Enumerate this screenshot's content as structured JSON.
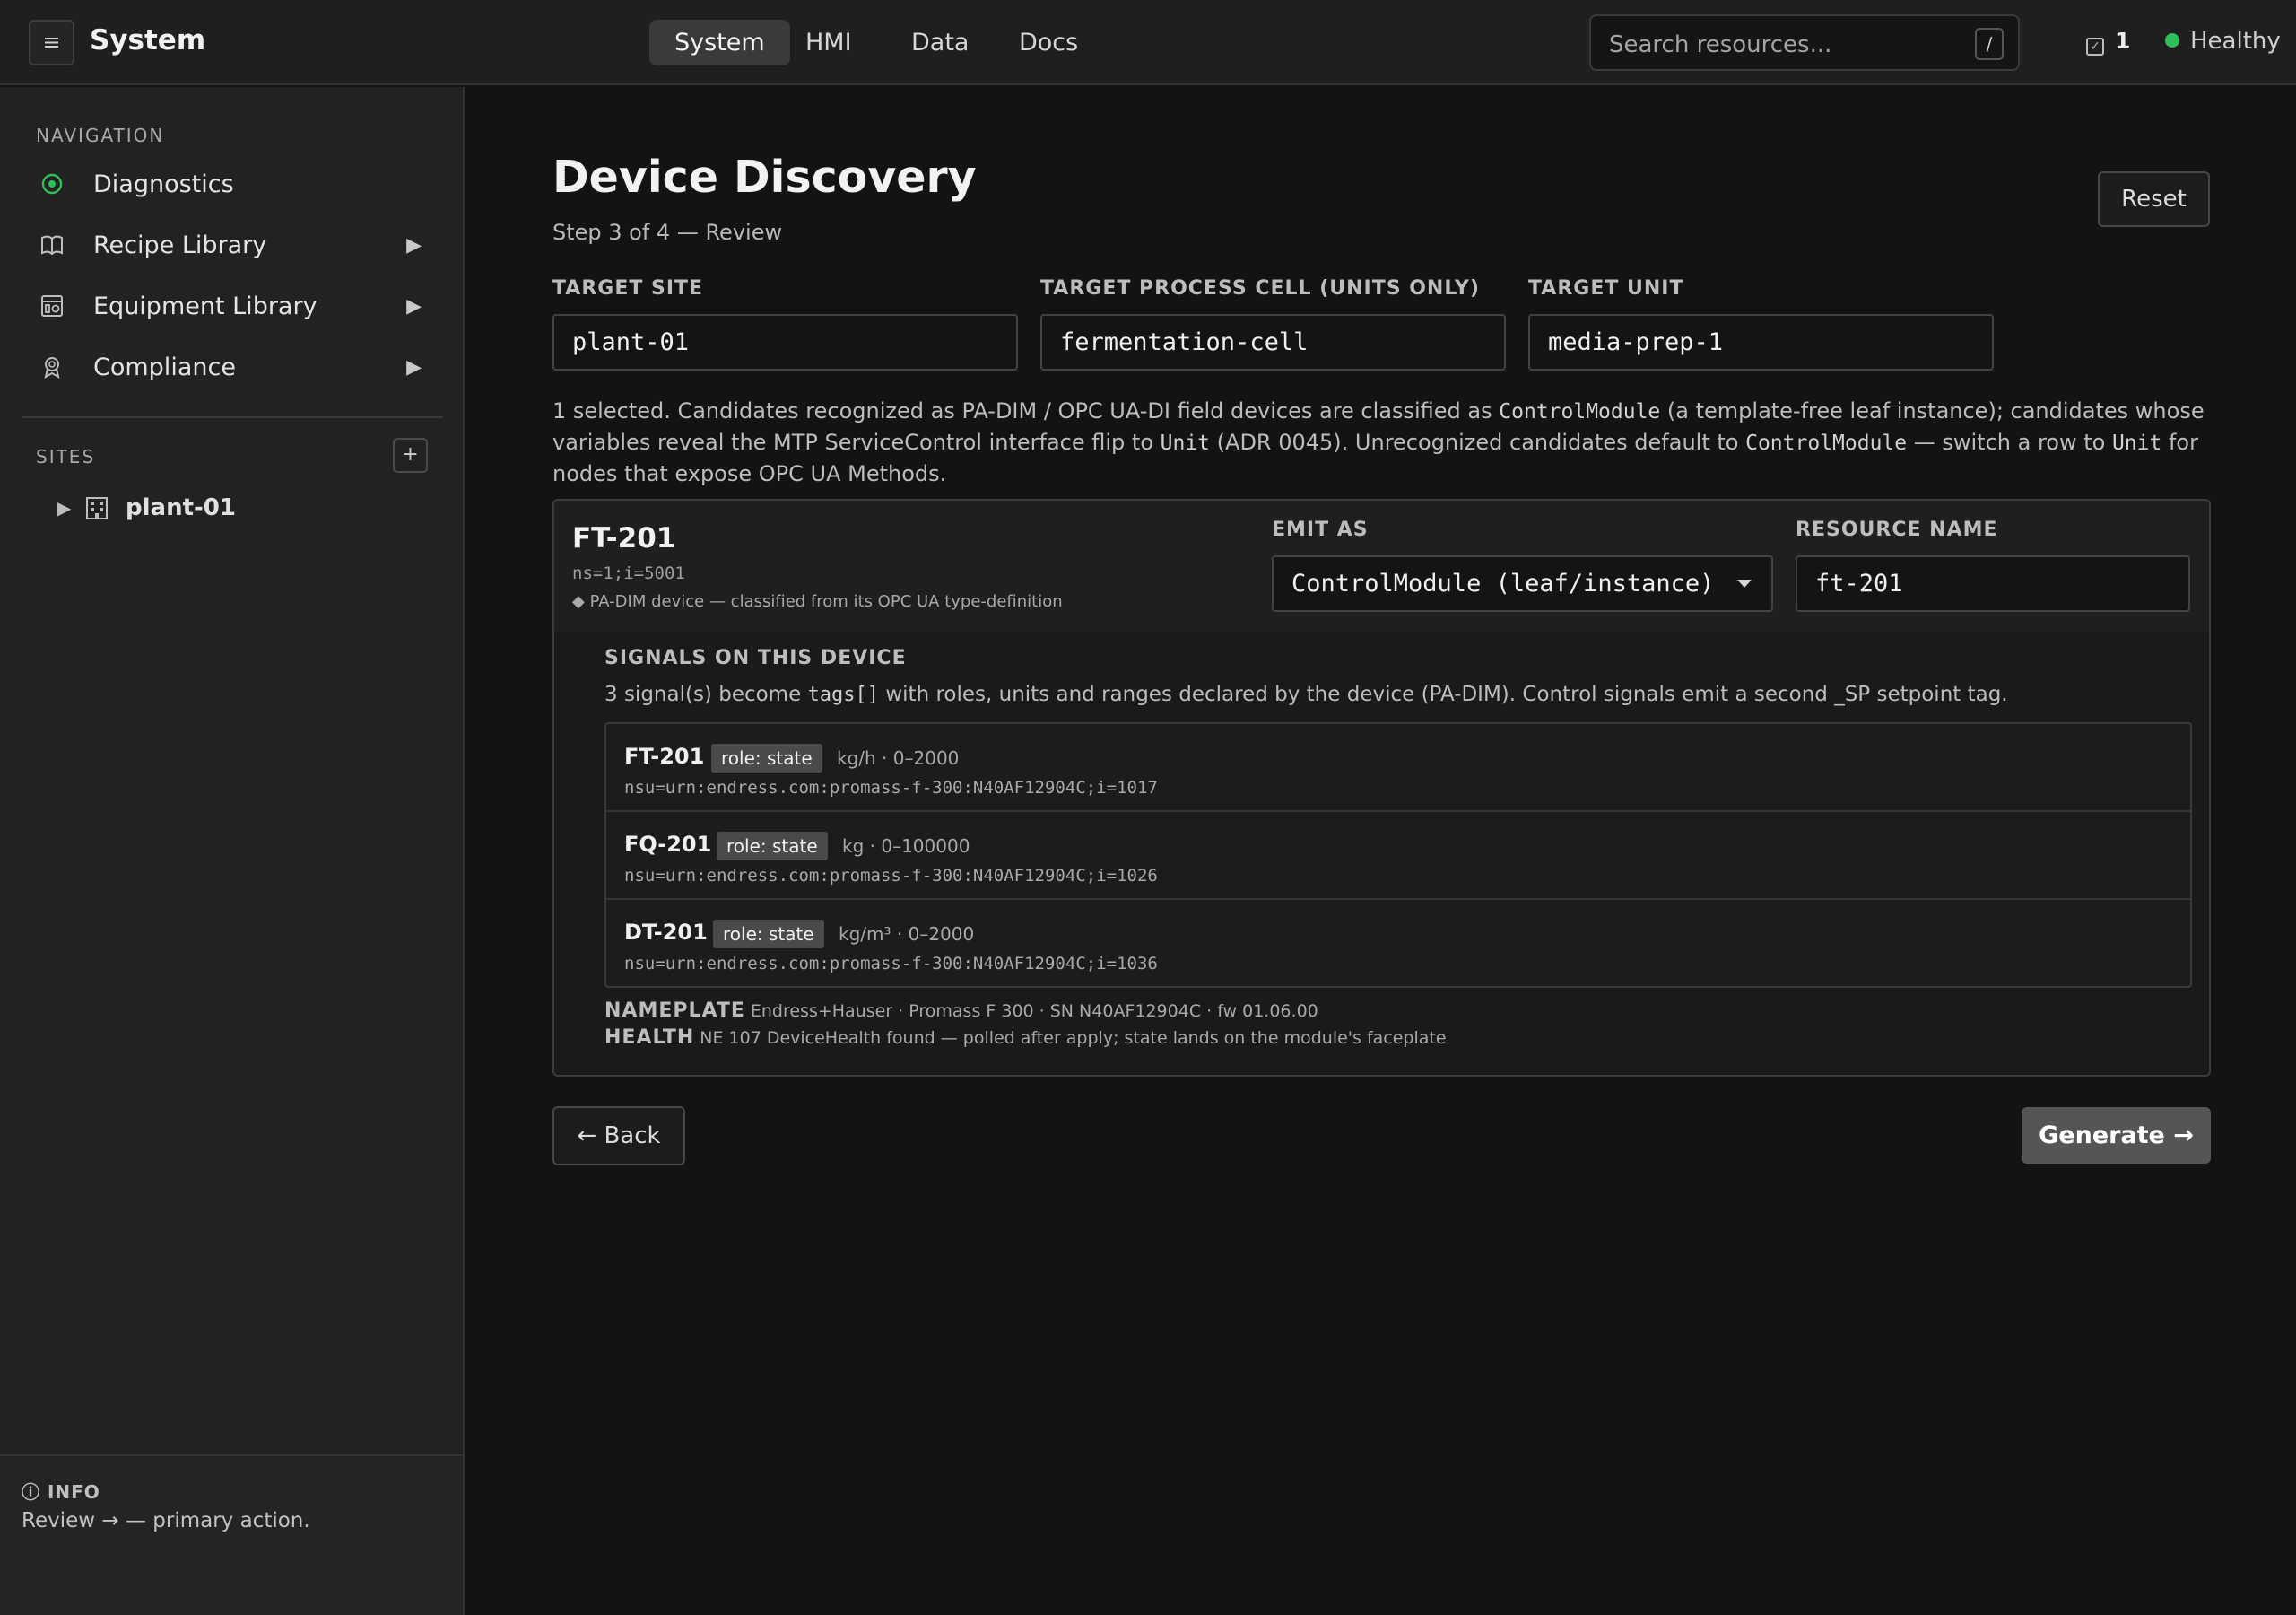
{
  "header": {
    "app_title": "System",
    "menu_icon": "≡",
    "tabs": [
      {
        "label": "System",
        "active": true
      },
      {
        "label": "HMI",
        "active": false
      },
      {
        "label": "Data",
        "active": false
      },
      {
        "label": "Docs",
        "active": false
      }
    ],
    "search": {
      "placeholder": "Search resources...",
      "shortcut": "/"
    },
    "tasks_count": "1",
    "status": {
      "label": "Healthy",
      "color": "#2fbf5a"
    }
  },
  "sidebar": {
    "nav_label": "NAVIGATION",
    "items": [
      {
        "label": "Diagnostics",
        "icon": "diagnostics-icon",
        "expandable": false
      },
      {
        "label": "Recipe Library",
        "icon": "book-icon",
        "expandable": true
      },
      {
        "label": "Equipment Library",
        "icon": "equipment-icon",
        "expandable": true
      },
      {
        "label": "Compliance",
        "icon": "badge-icon",
        "expandable": true
      }
    ],
    "expand_glyph": "▶",
    "sites_label": "SITES",
    "add_glyph": "+",
    "sites": [
      {
        "label": "plant-01"
      }
    ],
    "info": {
      "title": "INFO",
      "text": "Review → — primary action."
    }
  },
  "main": {
    "title": "Device Discovery",
    "step": "Step 3 of 4 — Review",
    "reset_label": "Reset",
    "fields": [
      {
        "label": "TARGET SITE",
        "value": "plant-01"
      },
      {
        "label": "TARGET PROCESS CELL (UNITS ONLY)",
        "value": "fermentation-cell"
      },
      {
        "label": "TARGET UNIT",
        "value": "media-prep-1"
      }
    ],
    "description": {
      "p1": "1 selected. Candidates recognized as PA-DIM / OPC UA-DI field devices are classified as ",
      "c1": "ControlModule",
      "p2": " (a template-free leaf instance); candidates whose variables reveal the MTP ServiceControl interface flip to ",
      "c2": "Unit",
      "p3": " (ADR 0045). Unrecognized candidates default to ",
      "c3": "ControlModule",
      "p4": " — switch a row to ",
      "c4": "Unit",
      "p5": " for nodes that expose OPC UA Methods."
    },
    "device": {
      "name": "FT-201",
      "node_id": "ns=1;i=5001",
      "classification": "◆ PA-DIM device — classified from its OPC UA type-definition",
      "emit_label": "EMIT AS",
      "emit_value": "ControlModule (leaf/instance)",
      "resource_label": "RESOURCE NAME",
      "resource_value": "ft-201",
      "signals_title": "SIGNALS ON THIS DEVICE",
      "signals_desc_a": "3 signal(s) become ",
      "signals_desc_code": "tags[]",
      "signals_desc_b": " with roles, units and ranges declared by the device (PA-DIM). Control signals emit a second _SP setpoint tag.",
      "signals": [
        {
          "tag": "FT-201",
          "role": "role: state",
          "units": "kg/h · 0–2000",
          "node": "nsu=urn:endress.com:promass-f-300:N40AF12904C;i=1017"
        },
        {
          "tag": "FQ-201",
          "role": "role: state",
          "units": "kg · 0–100000",
          "node": "nsu=urn:endress.com:promass-f-300:N40AF12904C;i=1026"
        },
        {
          "tag": "DT-201",
          "role": "role: state",
          "units": "kg/m³ · 0–2000",
          "node": "nsu=urn:endress.com:promass-f-300:N40AF12904C;i=1036"
        }
      ],
      "nameplate_label": "NAMEPLATE",
      "nameplate_value": "Endress+Hauser · Promass F 300 · SN N40AF12904C · fw 01.06.00",
      "health_label": "HEALTH",
      "health_value": "NE 107 DeviceHealth found — polled after apply; state lands on the module's faceplate"
    },
    "back_label": "← Back",
    "generate_label": "Generate →"
  }
}
